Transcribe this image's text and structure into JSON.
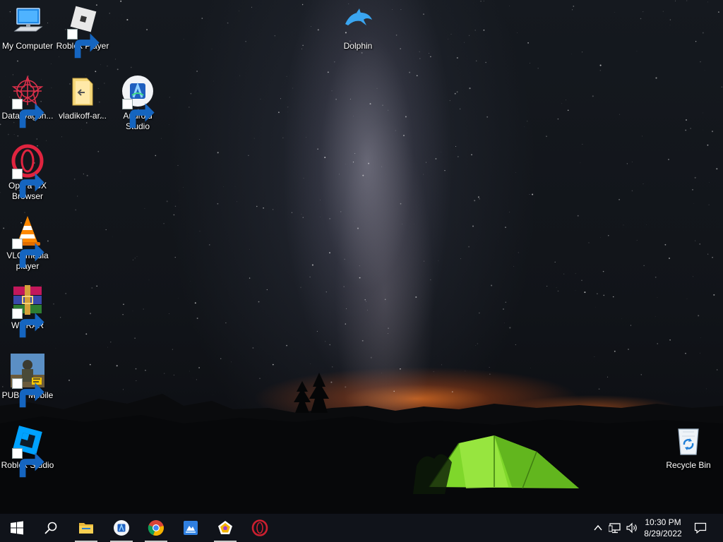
{
  "desktop": {
    "icons": [
      {
        "label": "My Computer",
        "icon": "computer-icon"
      },
      {
        "label": "Roblox Player",
        "icon": "roblox-icon"
      },
      {
        "label": "Dolphin",
        "icon": "dolphin-icon"
      },
      {
        "label": "DataWagon...",
        "icon": "datawagon-icon"
      },
      {
        "label": "vladikoff-ar...",
        "icon": "folder-icon"
      },
      {
        "label": "Android Studio",
        "icon": "android-studio-icon"
      },
      {
        "label": "Opera GX Browser",
        "icon": "opera-gx-icon"
      },
      {
        "label": "VLC media player",
        "icon": "vlc-icon"
      },
      {
        "label": "WinRAR",
        "icon": "winrar-icon"
      },
      {
        "label": "PUBG Mobile",
        "icon": "pubg-icon"
      },
      {
        "label": "Roblox Studio",
        "icon": "roblox-studio-icon"
      },
      {
        "label": "Recycle Bin",
        "icon": "recycle-bin-icon"
      }
    ]
  },
  "taskbar": {
    "pinned": [
      {
        "name": "start",
        "icon": "windows-logo-icon"
      },
      {
        "name": "search",
        "icon": "search-icon"
      },
      {
        "name": "file-explorer",
        "icon": "file-explorer-icon",
        "running": true
      },
      {
        "name": "android-studio",
        "icon": "android-studio-icon",
        "running": true
      },
      {
        "name": "chrome",
        "icon": "chrome-icon",
        "running": true
      },
      {
        "name": "app",
        "icon": "app-icon",
        "running": false
      },
      {
        "name": "app-pentagon",
        "icon": "pentagon-app-icon",
        "running": true
      },
      {
        "name": "opera",
        "icon": "opera-icon",
        "running": false
      }
    ],
    "tray": {
      "chevron": "chevron-up-icon",
      "network": "network-icon",
      "volume": "volume-icon",
      "notifications": "notification-icon"
    },
    "clock": {
      "time": "10:30 PM",
      "date": "8/29/2022"
    }
  },
  "colors": {
    "taskbar": "#10131a",
    "tent": "#7fd72b",
    "horizon_glow": "#e06a1e",
    "opera_red": "#cc1f2f"
  }
}
